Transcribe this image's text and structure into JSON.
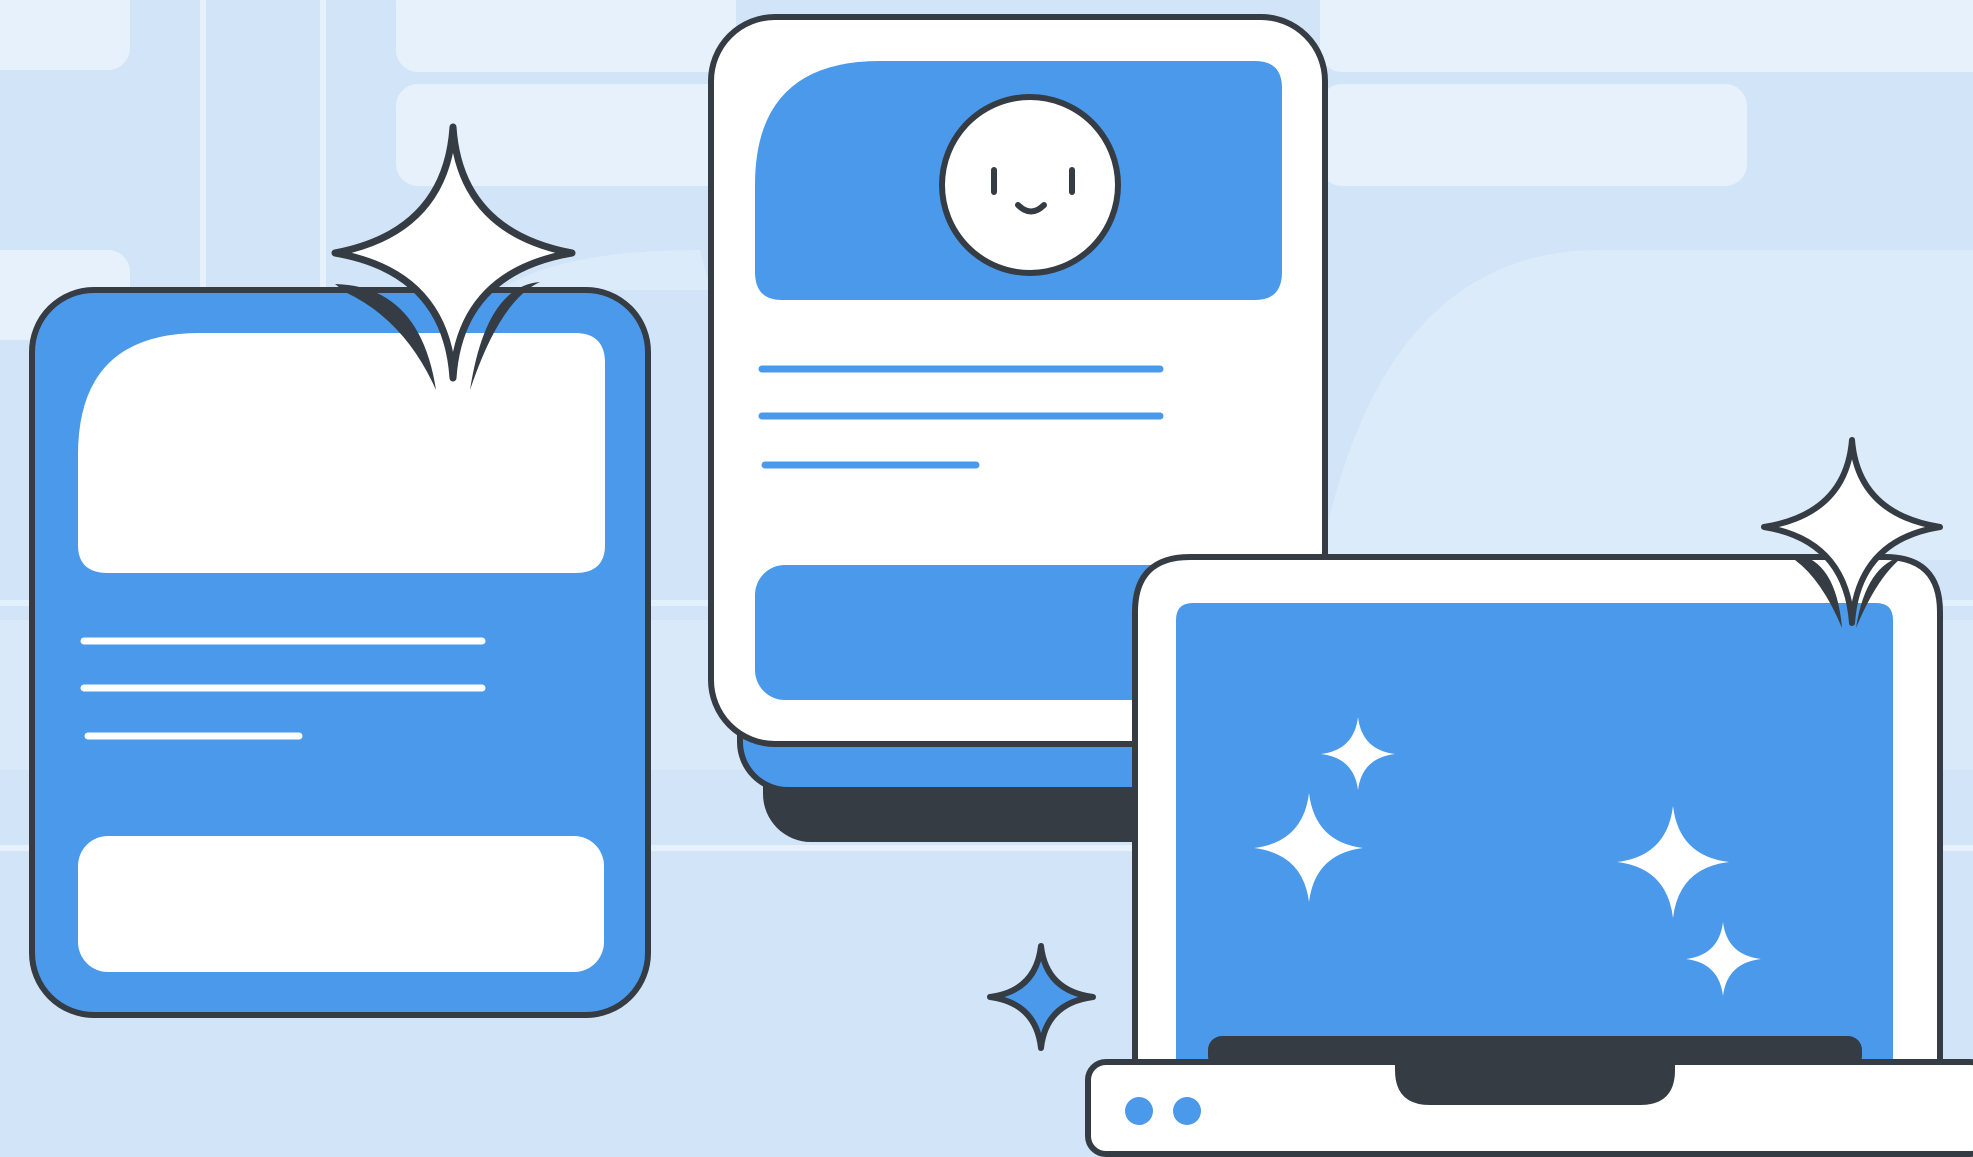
{
  "illustration": {
    "subject": "devices-with-sparkles",
    "colors": {
      "background": "#d2e5f8",
      "background_shape": "#e6f1fc",
      "primary_blue": "#4a99ea",
      "outline": "#353c44",
      "white": "#ffffff"
    },
    "elements": [
      {
        "name": "left-tablet",
        "fill": "#4a99ea"
      },
      {
        "name": "center-phone",
        "fill": "#ffffff",
        "avatar": "smiley-face-icon"
      },
      {
        "name": "laptop",
        "screen_fill": "#4a99ea"
      },
      {
        "name": "sparkle-icons",
        "count": 7
      }
    ]
  }
}
